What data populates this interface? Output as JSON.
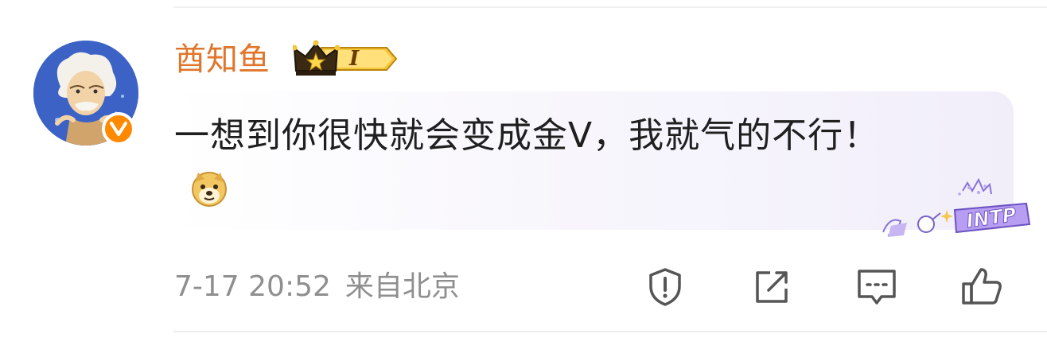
{
  "comment": {
    "username": "酋知鱼",
    "vip_level": "I",
    "text": "一想到你很快就会变成金V，我就气的不行！",
    "timestamp": "7-17 20:52",
    "location": "来自北京",
    "decoration_text": "INTP"
  },
  "icons": {
    "avatar": "avatar-einstein-cartoon",
    "verified": "orange-v-badge",
    "vip": "crown-vip-badge",
    "emoji": "doge-emoji",
    "actions": [
      "report-icon",
      "share-icon",
      "reply-icon",
      "like-icon"
    ]
  },
  "colors": {
    "username": "#e0762c",
    "verified": "#ff8a00",
    "meta": "#8f8f8f",
    "text": "#1f1f1f",
    "bubble": "#f1eefa"
  }
}
